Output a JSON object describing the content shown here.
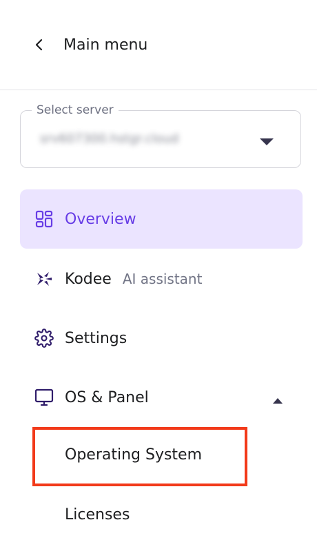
{
  "header": {
    "back_label": "Main menu",
    "back_icon": "chevron-left-icon"
  },
  "server_select": {
    "legend": "Select server",
    "value": "srv607300.hstgr.cloud",
    "caret_icon": "caret-down-icon"
  },
  "nav": {
    "items": [
      {
        "label": "Overview",
        "icon": "grid-icon",
        "active": true
      },
      {
        "label": "Kodee",
        "sublabel": "AI assistant",
        "icon": "sparkle-icon"
      },
      {
        "label": "Settings",
        "icon": "gear-icon"
      },
      {
        "label": "OS & Panel",
        "icon": "monitor-icon",
        "expanded": true
      }
    ],
    "subitems": [
      {
        "label": "Operating System",
        "highlighted": true
      },
      {
        "label": "Licenses"
      }
    ]
  },
  "colors": {
    "accent": "#673de6",
    "active_bg": "#ebe4ff",
    "highlight": "#f23a1a",
    "text": "#1d1e20",
    "muted": "#727586"
  }
}
